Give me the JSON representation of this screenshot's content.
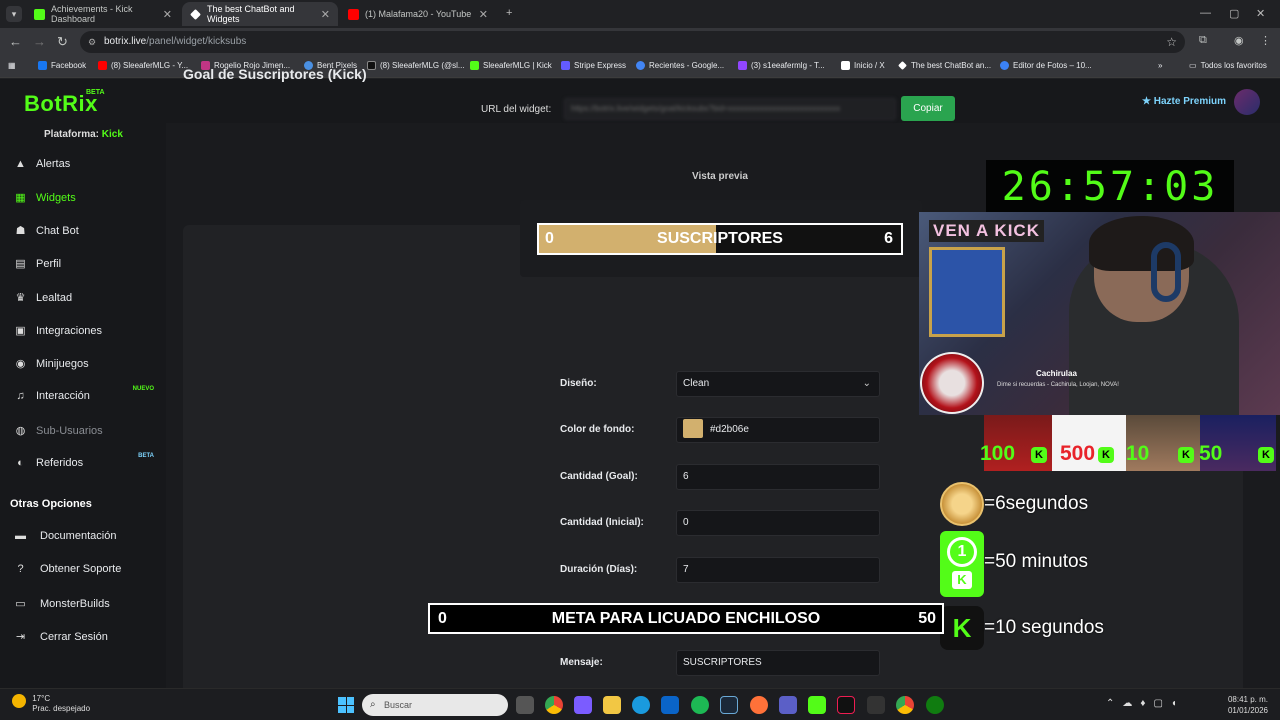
{
  "browser": {
    "tabs": [
      {
        "title": "Achievements - Kick Dashboard",
        "color": "#53fc18"
      },
      {
        "title": "The best ChatBot and Widgets",
        "color": "#ffffff"
      },
      {
        "title": "(1) Malafama20 - YouTube",
        "color": "#ff0000"
      }
    ],
    "url_host": "botrix.live",
    "url_path": "/panel/widget/kicksubs",
    "bookmarks": [
      {
        "label": "Facebook",
        "color": "#1877f2"
      },
      {
        "label": "(8) SleeaferMLG - Y...",
        "color": "#ff0000"
      },
      {
        "label": "Rogelio Rojo Jimen...",
        "color": "#c13584"
      },
      {
        "label": "Bent Pixels",
        "color": "#4a90e2"
      },
      {
        "label": "(8) SleeaferMLG (@sl...",
        "color": "#111111"
      },
      {
        "label": "SleeaferMLG | Kick",
        "color": "#53fc18"
      },
      {
        "label": "Stripe Express",
        "color": "#635bff"
      },
      {
        "label": "Recientes - Google...",
        "color": "#4285f4"
      },
      {
        "label": "(3) s1eeafermlg - T...",
        "color": "#9146ff"
      },
      {
        "label": "Inicio / X",
        "color": "#ffffff"
      },
      {
        "label": "The best ChatBot an...",
        "color": "#ffffff"
      },
      {
        "label": "Editor de Fotos – 10...",
        "color": "#3b82f6"
      }
    ],
    "all_bookmarks": "Todos los favoritos"
  },
  "app": {
    "logo": "BotRix",
    "logo_badge": "BETA",
    "premium": "Hazte Premium",
    "platform_label": "Plataforma:",
    "platform_value": "Kick",
    "menu": [
      {
        "label": "Alertas",
        "icon": "warning-icon",
        "glyph": "▲"
      },
      {
        "label": "Widgets",
        "icon": "grid-icon",
        "glyph": "▦"
      },
      {
        "label": "Chat Bot",
        "icon": "robot-icon",
        "glyph": "☗"
      },
      {
        "label": "Perfil",
        "icon": "id-card-icon",
        "glyph": "▤"
      },
      {
        "label": "Lealtad",
        "icon": "trophy-icon",
        "glyph": "♛"
      },
      {
        "label": "Integraciones",
        "icon": "plug-icon",
        "glyph": "▣"
      },
      {
        "label": "Minijuegos",
        "icon": "gamepad-icon",
        "glyph": "◉"
      },
      {
        "label": "Interacción",
        "icon": "music-icon",
        "glyph": "♫",
        "badge": "NUEVO"
      },
      {
        "label": "Sub-Usuarios",
        "icon": "users-icon",
        "glyph": "◍"
      },
      {
        "label": "Referidos",
        "icon": "referral-icon",
        "glyph": "◐",
        "badge": "BETA"
      }
    ],
    "other_title": "Otras Opciones",
    "other": [
      {
        "label": "Documentación",
        "icon": "book-icon",
        "glyph": "▬"
      },
      {
        "label": "Obtener Soporte",
        "icon": "help-icon",
        "glyph": "?"
      },
      {
        "label": "MonsterBuilds",
        "icon": "monitor-icon",
        "glyph": "▭"
      },
      {
        "label": "Cerrar Sesión",
        "icon": "logout-icon",
        "glyph": "⇥"
      }
    ]
  },
  "page": {
    "title": "Goal de Suscriptores (Kick)",
    "url_label": "URL del widget:",
    "url_value": "https://botrix.live/widgets/goal/kicksubs?bid=xxxxxxxxxxxxxxxxxxxxxxxxxxxx",
    "copy_label": "Copiar",
    "preview_label": "Vista previa",
    "preview": {
      "start": "0",
      "title": "SUSCRIPTORES",
      "end": "6",
      "fill_fraction": 0.49,
      "color": "#d2b06e"
    },
    "fields": [
      {
        "label": "Diseño:",
        "value": "Clean",
        "type": "select"
      },
      {
        "label": "Color de fondo:",
        "value": "#d2b06e",
        "type": "color"
      },
      {
        "label": "Cantidad (Goal):",
        "value": "6",
        "type": "text"
      },
      {
        "label": "Cantidad (Inicial):",
        "value": "0",
        "type": "text"
      },
      {
        "label": "Duración (Días):",
        "value": "7",
        "type": "text"
      },
      {
        "label": "Mensaje:",
        "value": "SUSCRIPTORES",
        "type": "text"
      }
    ]
  },
  "overlay": {
    "timer": "26:57:03",
    "cam_sign": "VEN A KICK",
    "alert_name": "Cachirulaa",
    "alert_message": "Dime si recuerdas - Cachirula, Loojan, NOVA!",
    "tiles": [
      "100",
      "500",
      "10",
      "50"
    ],
    "rules": [
      "=6segundos",
      "=50 minutos",
      "=10 segundos"
    ],
    "goal2": {
      "start": "0",
      "title": "META PARA LICUADO ENCHILOSO",
      "end": "50"
    }
  },
  "taskbar": {
    "temp": "17°C",
    "weather": "Prac. despejado",
    "search_placeholder": "Buscar",
    "time": "08:41 p. m.",
    "date": "01/01/2026"
  }
}
